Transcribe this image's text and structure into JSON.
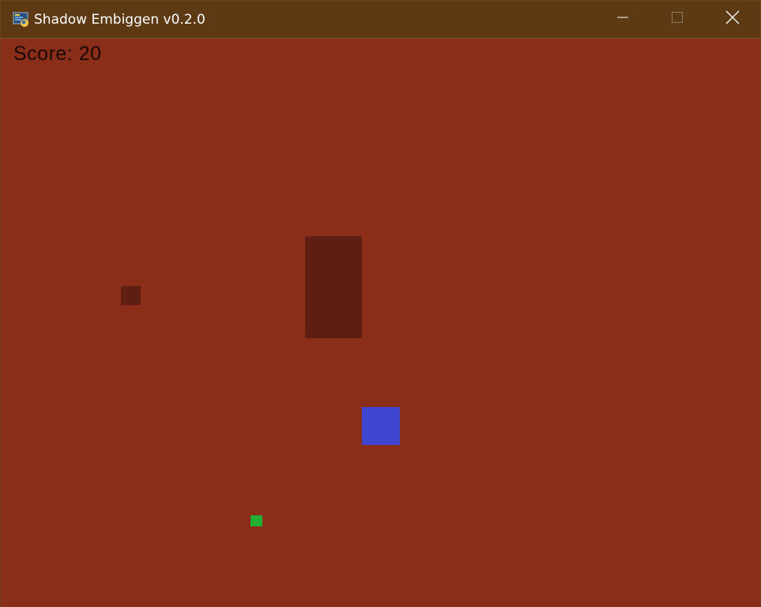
{
  "window": {
    "title": "Shadow Embiggen v0.2.0",
    "icons": {
      "app": "python-app-icon",
      "minimize": "minimize-icon",
      "maximize": "maximize-icon",
      "close": "close-icon"
    }
  },
  "game": {
    "score_text": "Score: 20",
    "score": 20,
    "colors": {
      "background": "#8a2d19",
      "obstacle": "#5e1e11",
      "player": "#4046d2",
      "pickup": "#22b032",
      "titlebar": "#5e3a14"
    }
  }
}
